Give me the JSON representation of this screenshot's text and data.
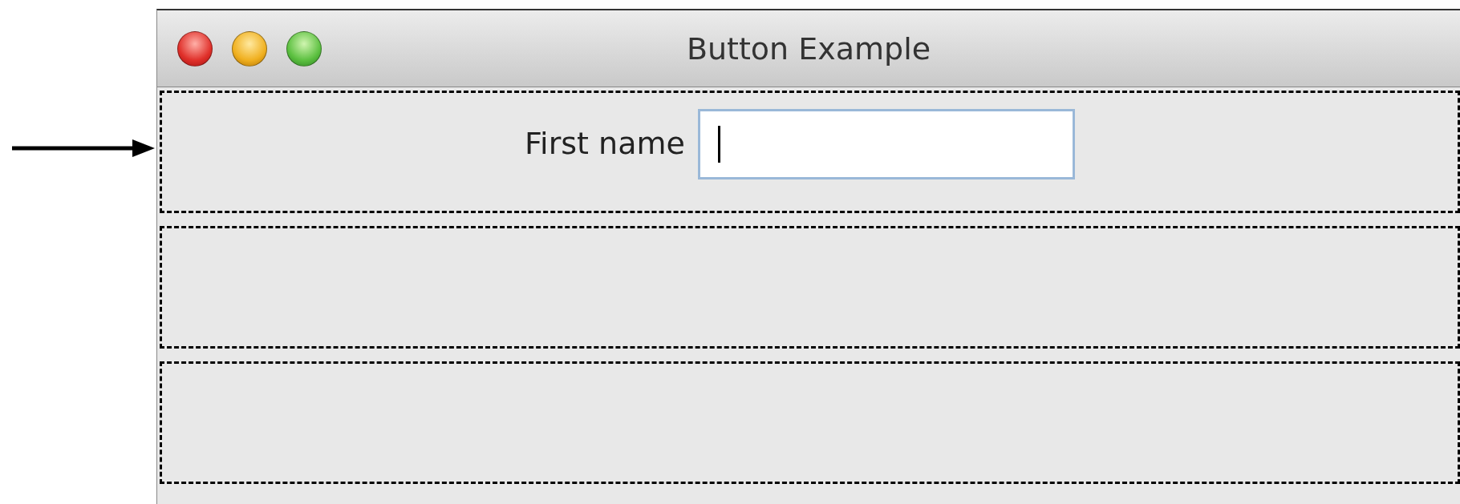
{
  "window": {
    "title": "Button Example"
  },
  "form": {
    "label": "First name",
    "field": {
      "focused": true
    }
  },
  "panels": [
    {
      "kind": "form"
    },
    {
      "kind": "empty"
    },
    {
      "kind": "empty"
    }
  ]
}
